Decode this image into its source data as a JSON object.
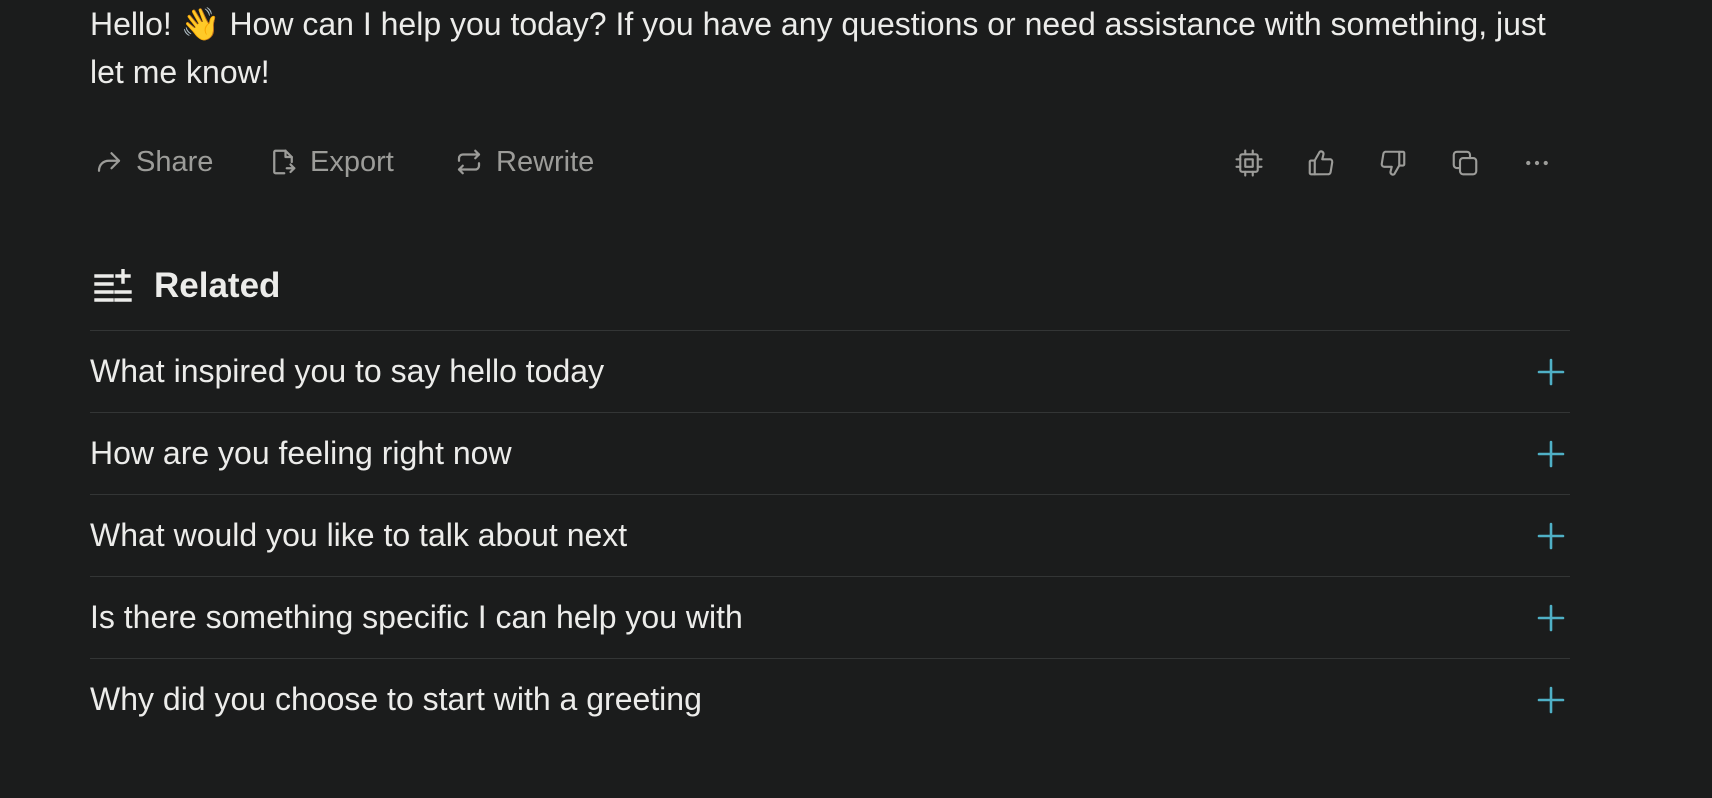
{
  "answer": {
    "text": "Hello! 👋 How can I help you today? If you have any questions or need assistance with something, just let me know!"
  },
  "toolbar": {
    "share_label": "Share",
    "export_label": "Export",
    "rewrite_label": "Rewrite",
    "icons": [
      "cpu-icon",
      "thumbs-up-icon",
      "thumbs-down-icon",
      "copy-icon",
      "more-icon"
    ]
  },
  "related": {
    "title": "Related",
    "items": [
      "What inspired you to say hello today",
      "How are you feeling right now",
      "What would you like to talk about next",
      "Is there something specific I can help you with",
      "Why did you choose to start with a greeting"
    ]
  },
  "colors": {
    "background": "#1b1c1c",
    "text": "#ececea",
    "muted": "#9c9c99",
    "accent": "#4fb0c6",
    "divider": "#333535"
  }
}
